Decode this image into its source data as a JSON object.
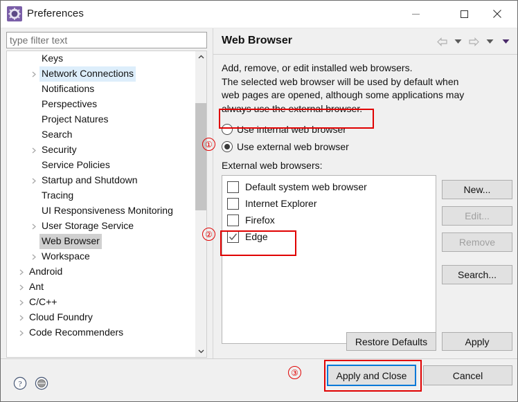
{
  "window": {
    "title": "Preferences",
    "app_icon": "gear-icon",
    "controls": {
      "minimize": "minimize-icon",
      "maximize": "maximize-icon",
      "close": "close-icon"
    }
  },
  "filter": {
    "placeholder": "type filter text",
    "value": ""
  },
  "tree": {
    "items": [
      {
        "label": "Keys",
        "indent": 1,
        "expandable": false,
        "state": "normal"
      },
      {
        "label": "Network Connections",
        "indent": 1,
        "expandable": true,
        "state": "sel-blue"
      },
      {
        "label": "Notifications",
        "indent": 1,
        "expandable": false,
        "state": "normal"
      },
      {
        "label": "Perspectives",
        "indent": 1,
        "expandable": false,
        "state": "normal"
      },
      {
        "label": "Project Natures",
        "indent": 1,
        "expandable": false,
        "state": "normal"
      },
      {
        "label": "Search",
        "indent": 1,
        "expandable": false,
        "state": "normal"
      },
      {
        "label": "Security",
        "indent": 1,
        "expandable": true,
        "state": "normal"
      },
      {
        "label": "Service Policies",
        "indent": 1,
        "expandable": false,
        "state": "normal"
      },
      {
        "label": "Startup and Shutdown",
        "indent": 1,
        "expandable": true,
        "state": "normal"
      },
      {
        "label": "Tracing",
        "indent": 1,
        "expandable": false,
        "state": "normal"
      },
      {
        "label": "UI Responsiveness Monitoring",
        "indent": 1,
        "expandable": false,
        "state": "normal"
      },
      {
        "label": "User Storage Service",
        "indent": 1,
        "expandable": true,
        "state": "normal"
      },
      {
        "label": "Web Browser",
        "indent": 1,
        "expandable": false,
        "state": "sel-grey"
      },
      {
        "label": "Workspace",
        "indent": 1,
        "expandable": true,
        "state": "normal"
      },
      {
        "label": "Android",
        "indent": 0,
        "expandable": true,
        "state": "normal"
      },
      {
        "label": "Ant",
        "indent": 0,
        "expandable": true,
        "state": "normal"
      },
      {
        "label": "C/C++",
        "indent": 0,
        "expandable": true,
        "state": "normal"
      },
      {
        "label": "Cloud Foundry",
        "indent": 0,
        "expandable": true,
        "state": "normal"
      },
      {
        "label": "Code Recommenders",
        "indent": 0,
        "expandable": true,
        "state": "normal"
      }
    ],
    "scrollbar": {
      "up_arrow": "chevron-up-icon",
      "down_arrow": "chevron-down-icon"
    }
  },
  "panel": {
    "title": "Web Browser",
    "nav": [
      {
        "icon": "back-arrow-icon"
      },
      {
        "icon": "chevron-down-icon"
      },
      {
        "icon": "forward-arrow-icon"
      },
      {
        "icon": "chevron-down-icon"
      },
      {
        "icon": "chevron-down-filled-icon"
      }
    ],
    "description": [
      "Add, remove, or edit installed web browsers.",
      "The selected web browser will be used by default when",
      "web pages are opened, although some applications may",
      "always use the external browser."
    ],
    "radios": [
      {
        "label": "Use internal web browser",
        "checked": false
      },
      {
        "label": "Use external web browser",
        "checked": true
      }
    ],
    "browsers_label": "External web browsers:",
    "browsers": [
      {
        "label": "Default system web browser",
        "checked": false
      },
      {
        "label": "Internet Explorer",
        "checked": false
      },
      {
        "label": "Firefox",
        "checked": false
      },
      {
        "label": "Edge",
        "checked": true
      }
    ],
    "side_buttons": [
      {
        "label": "New...",
        "enabled": true
      },
      {
        "label": "Edit...",
        "enabled": false
      },
      {
        "label": "Remove",
        "enabled": false
      },
      {
        "label": "Search...",
        "enabled": true
      }
    ],
    "restore_defaults_label": "Restore Defaults",
    "apply_label": "Apply"
  },
  "footer": {
    "help_icon": "help-question-icon",
    "secondary_icon": "circle-icon",
    "apply_and_close_label": "Apply and Close",
    "cancel_label": "Cancel"
  },
  "annotations": {
    "markers": [
      {
        "num": "①"
      },
      {
        "num": "②"
      },
      {
        "num": "③"
      }
    ],
    "color": "#e00000"
  }
}
